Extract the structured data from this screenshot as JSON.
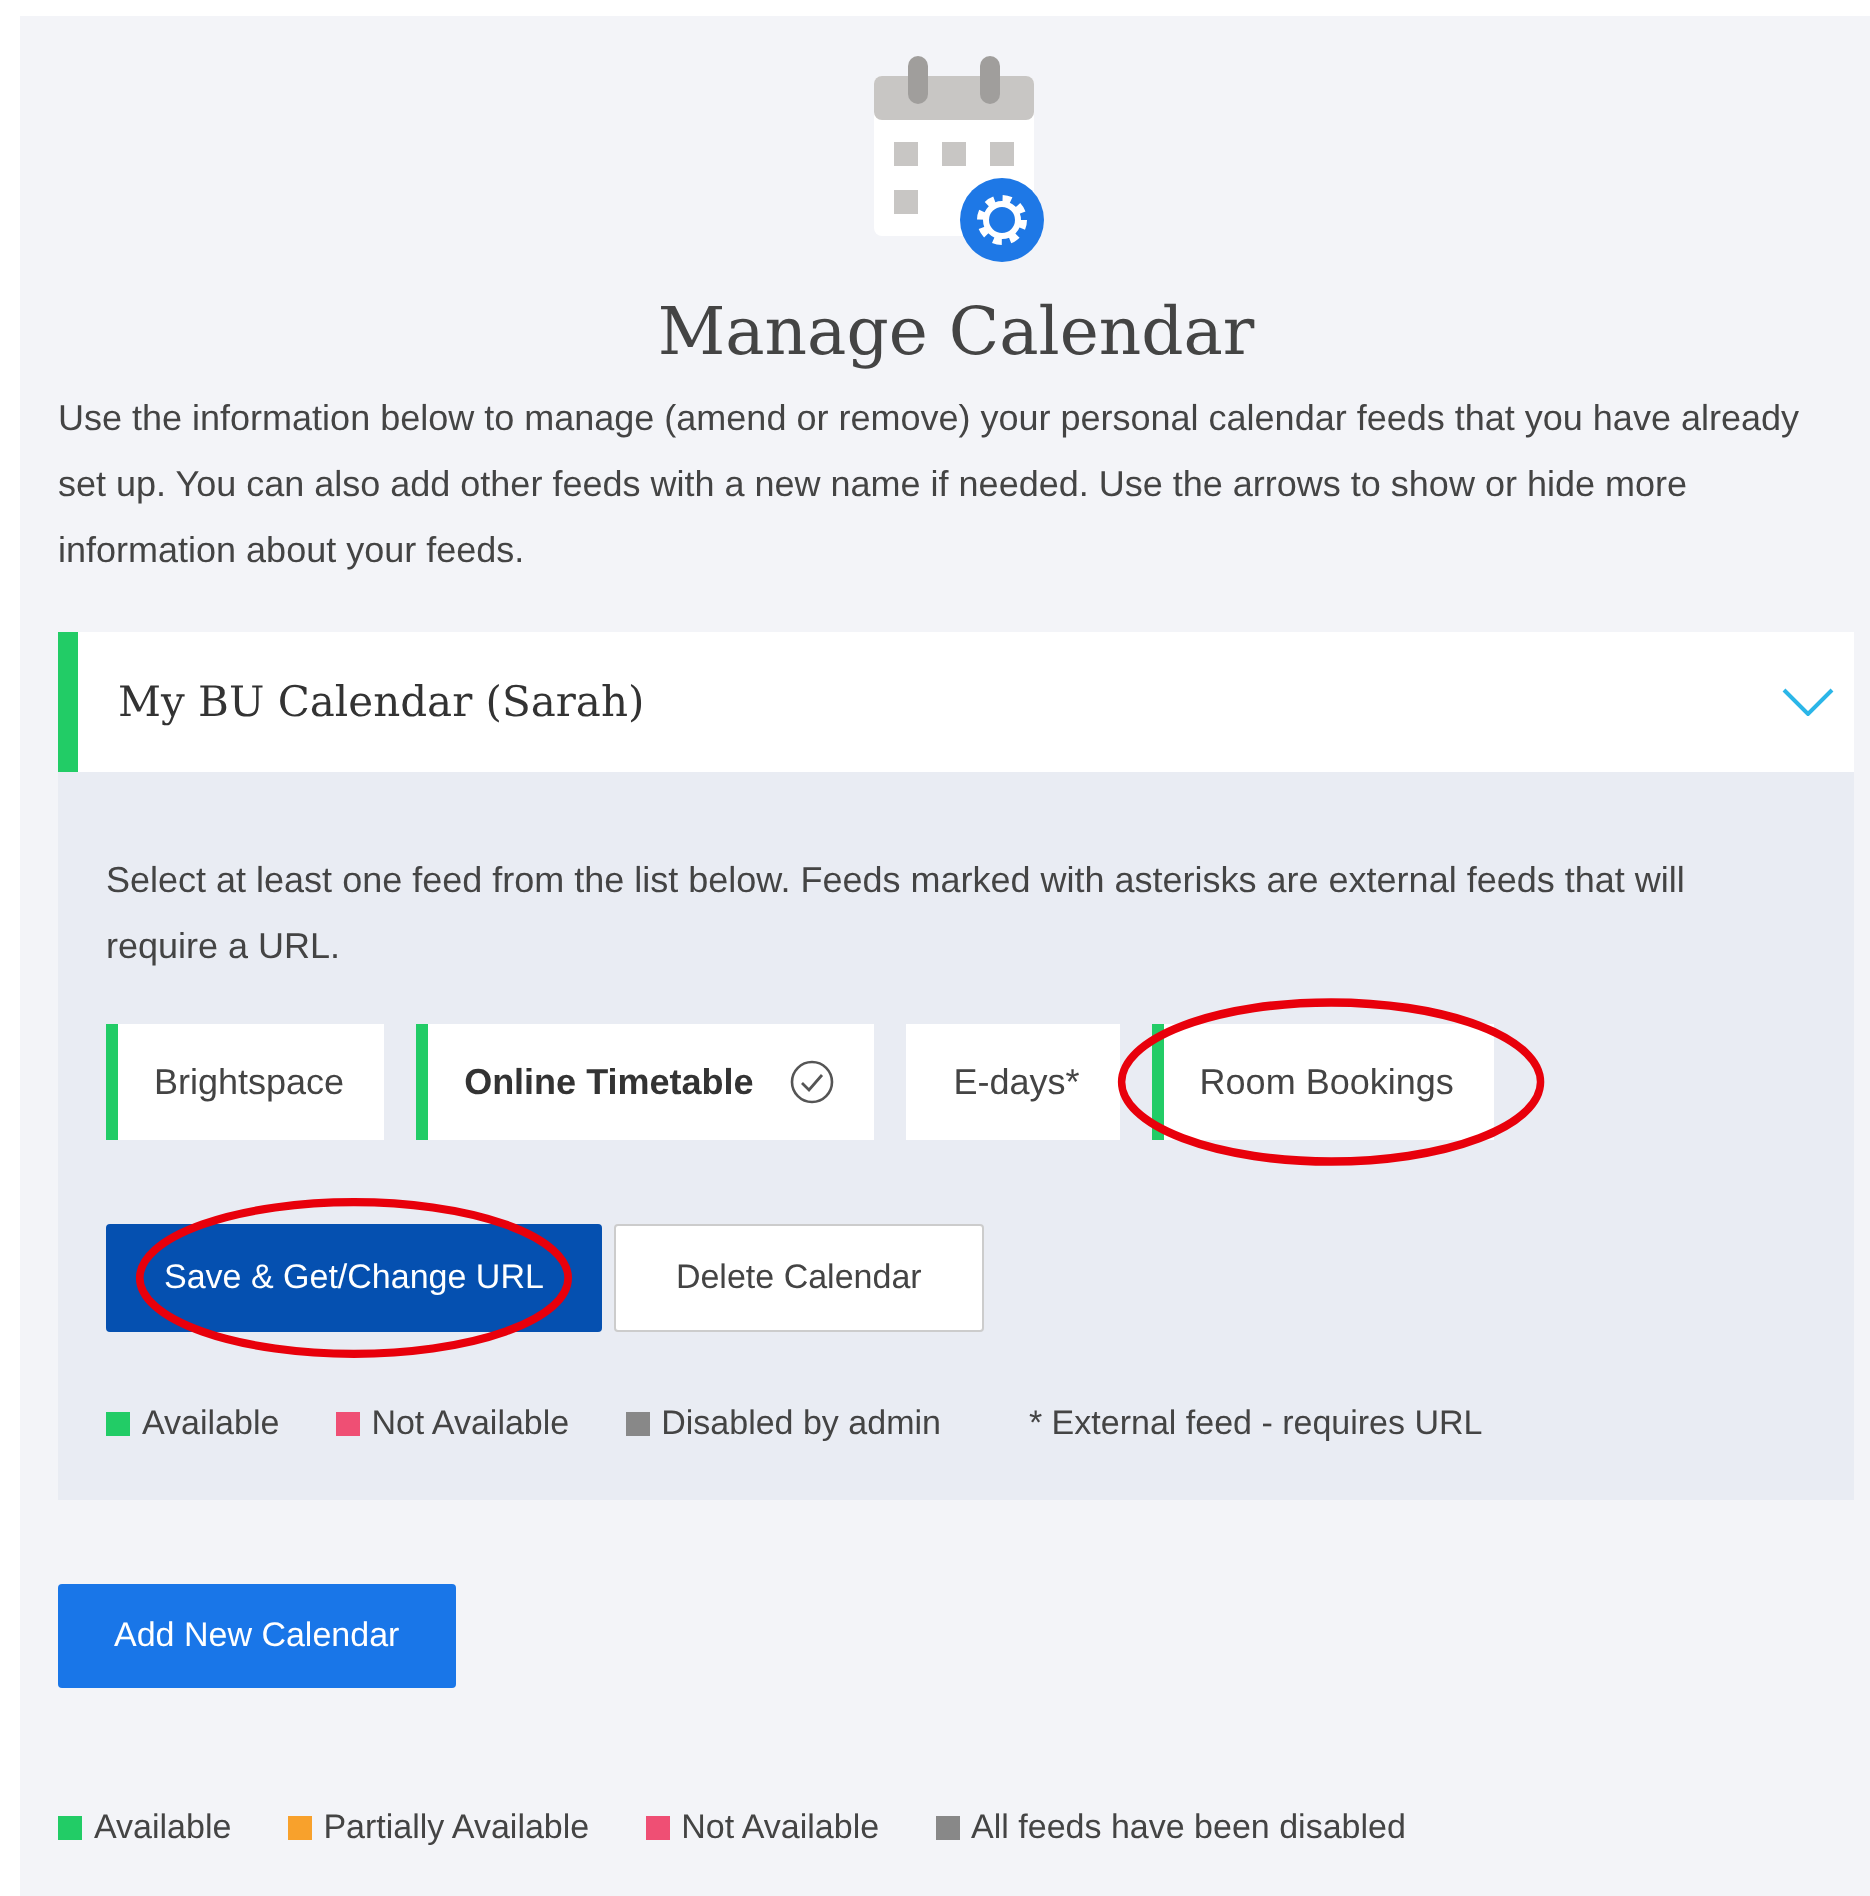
{
  "title": "Manage Calendar",
  "intro": "Use the information below to manage (amend or remove) your personal calendar feeds that you have already set up. You can also add other feeds with a new name if needed. Use the arrows to show or hide more information about your feeds.",
  "calendar": {
    "name": "My BU Calendar (Sarah)",
    "color": "#22cc66",
    "expanded": true,
    "instructions": "Select at least one feed from the list below. Feeds marked with asterisks are external feeds that will require a URL.",
    "feeds": [
      {
        "label": "Brightspace",
        "color": "#22cc66",
        "selected": false,
        "circled": false
      },
      {
        "label": "Online Timetable",
        "color": "#22cc66",
        "selected": true,
        "circled": false
      },
      {
        "label": "E-days*",
        "selected": false,
        "circled": false
      },
      {
        "label": "Room Bookings",
        "color": "#22cc66",
        "selected": false,
        "circled": true
      }
    ],
    "buttons": [
      {
        "label": "Save & Get/Change URL",
        "kind": "primary",
        "circled": true
      },
      {
        "label": "Delete Calendar",
        "kind": "secondary",
        "circled": false
      }
    ],
    "legend": [
      {
        "label": "Available",
        "color": "#22cc66"
      },
      {
        "label": "Not Available",
        "color": "#ef4f74"
      },
      {
        "label": "Disabled by admin",
        "color": "#888888"
      }
    ],
    "note": "* External feed - requires URL"
  },
  "add_button": "Add New Calendar",
  "legend": [
    {
      "label": "Available",
      "color": "#22cc66"
    },
    {
      "label": "Partially Available",
      "color": "#f8a12c"
    },
    {
      "label": "Not Available",
      "color": "#ef4f74"
    },
    {
      "label": "All feeds have been disabled",
      "color": "#888888"
    }
  ]
}
